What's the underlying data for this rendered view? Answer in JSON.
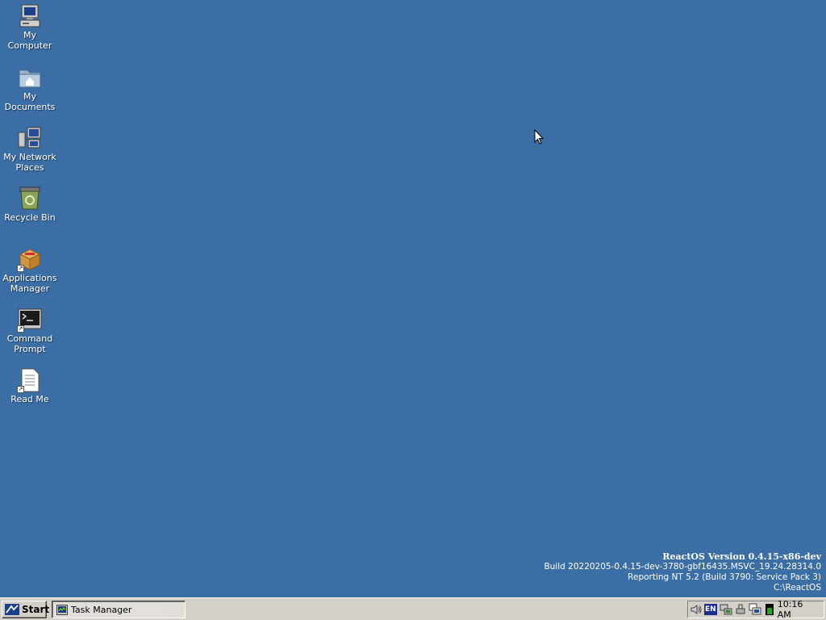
{
  "desktop": {
    "background_color": "#3a6ea5",
    "icons": [
      {
        "label": "My Computer",
        "icon": "computer-icon"
      },
      {
        "label": "My Documents",
        "icon": "documents-folder-icon"
      },
      {
        "label": "My Network Places",
        "icon": "network-places-icon"
      },
      {
        "label": "Recycle Bin",
        "icon": "recycle-bin-icon"
      },
      {
        "label": "Applications Manager",
        "icon": "applications-manager-icon"
      },
      {
        "label": "Command Prompt",
        "icon": "command-prompt-icon"
      },
      {
        "label": "Read Me",
        "icon": "readme-document-icon"
      }
    ]
  },
  "version_info": {
    "title": "ReactOS Version 0.4.15-x86-dev",
    "build": "Build 20220205-0.4.15-dev-3780-gbf16435.MSVC_19.24.28314.0",
    "reporting": "Reporting NT 5.2 (Build 3790: Service Pack 3)",
    "path": "C:\\ReactOS"
  },
  "taskbar": {
    "start_label": "Start",
    "tasks": [
      {
        "label": "Task Manager",
        "icon": "task-manager-icon"
      }
    ],
    "tray": {
      "language": "EN",
      "clock": "10:16 AM"
    }
  }
}
